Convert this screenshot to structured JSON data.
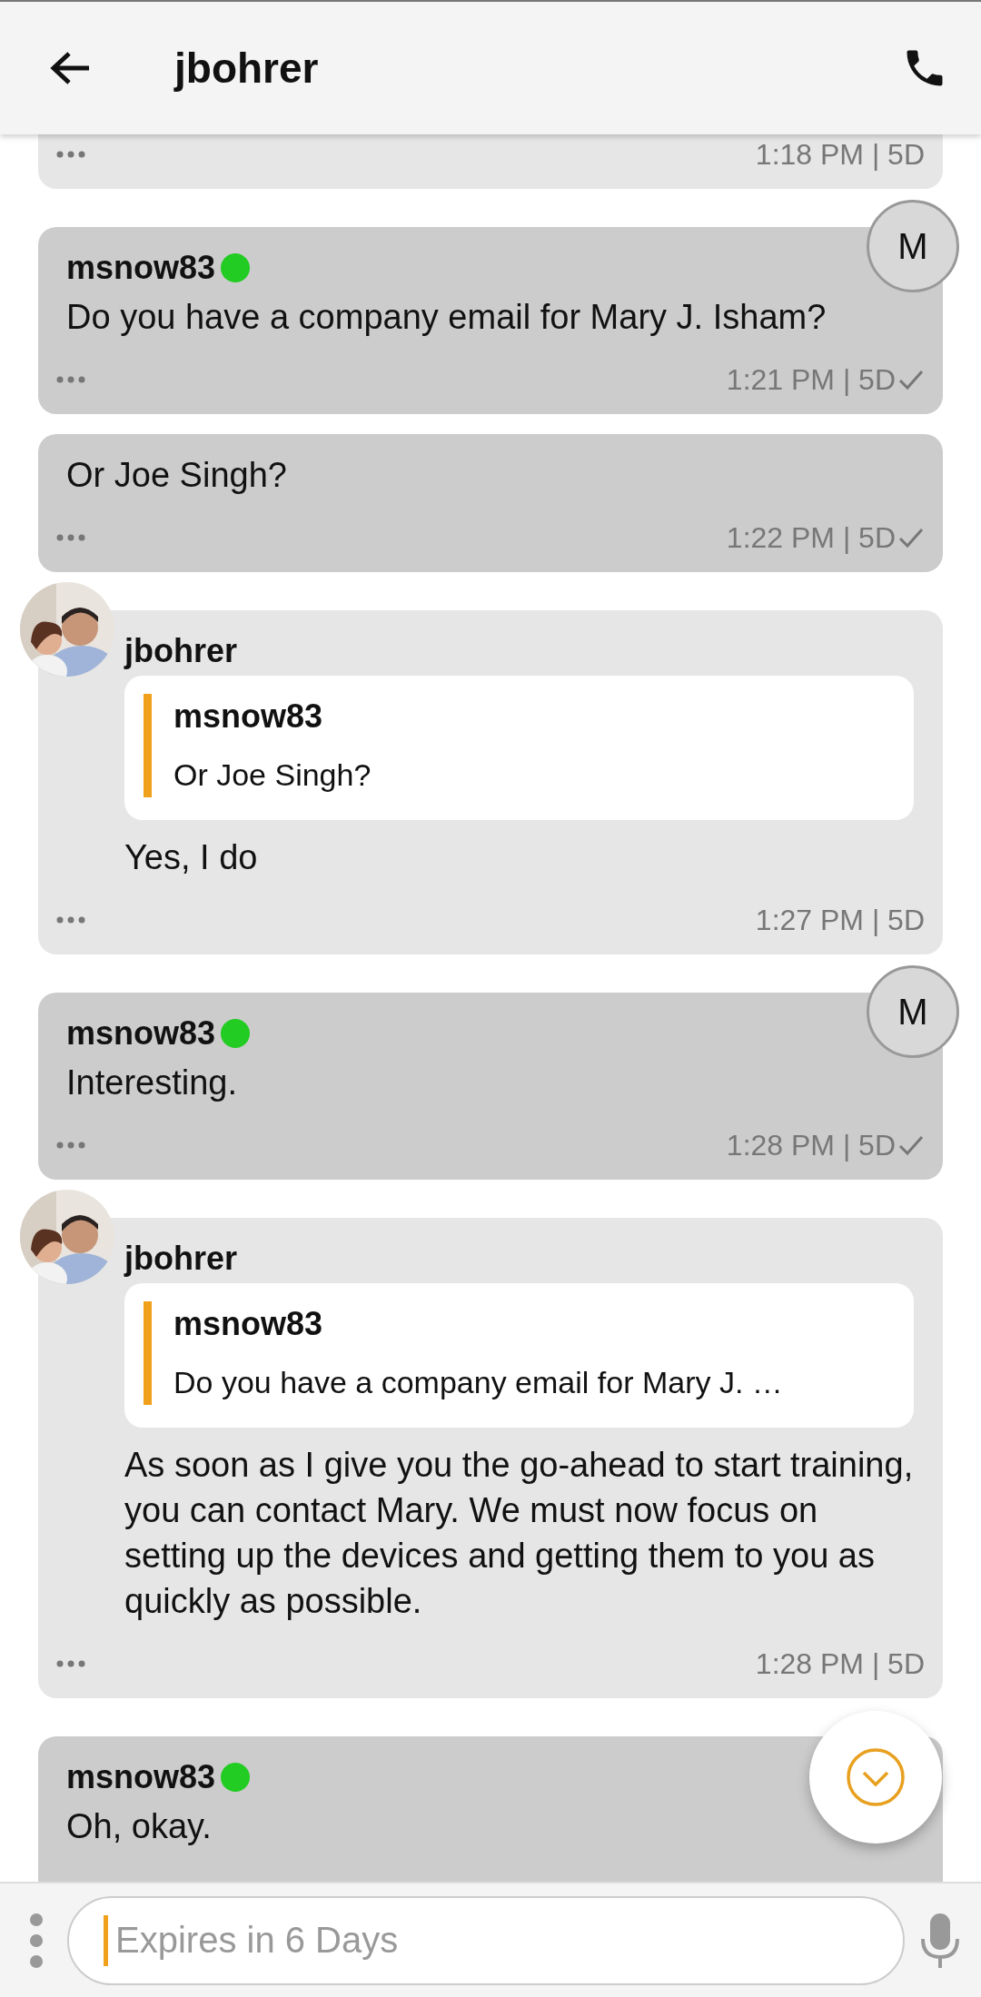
{
  "header": {
    "title": "jbohrer"
  },
  "messages": [
    {
      "kind": "incoming",
      "time": "1:18 PM | 5D"
    },
    {
      "kind": "outgoing",
      "sender": "msnow83",
      "online": true,
      "read": true,
      "avatar": {
        "kind": "letter",
        "letter": "M"
      },
      "text": "Do you have a company email for Mary J. Isham?",
      "time": "1:21 PM | 5D"
    },
    {
      "kind": "outgoing",
      "read": true,
      "text": "Or Joe Singh?",
      "time": "1:22 PM | 5D"
    },
    {
      "kind": "incoming",
      "sender": "jbohrer",
      "quote": {
        "sender": "msnow83",
        "text": "Or Joe Singh?"
      },
      "text": "Yes, I do",
      "time": "1:27 PM | 5D"
    },
    {
      "kind": "outgoing",
      "sender": "msnow83",
      "online": true,
      "read": true,
      "avatar": {
        "kind": "letter",
        "letter": "M"
      },
      "text": "Interesting.",
      "time": "1:28 PM | 5D"
    },
    {
      "kind": "incoming",
      "sender": "jbohrer",
      "quote": {
        "sender": "msnow83",
        "text": "Do you have a company email for Mary J. …"
      },
      "text": "As soon as I give you the go-ahead to start training, you can contact Mary. We must now focus on setting up the devices and getting them to you as quickly as possible.",
      "time": "1:28 PM | 5D"
    },
    {
      "kind": "outgoing",
      "sender": "msnow83",
      "online": true,
      "text": "Oh, okay."
    }
  ],
  "composer": {
    "placeholder": "Expires in 6 Days"
  }
}
